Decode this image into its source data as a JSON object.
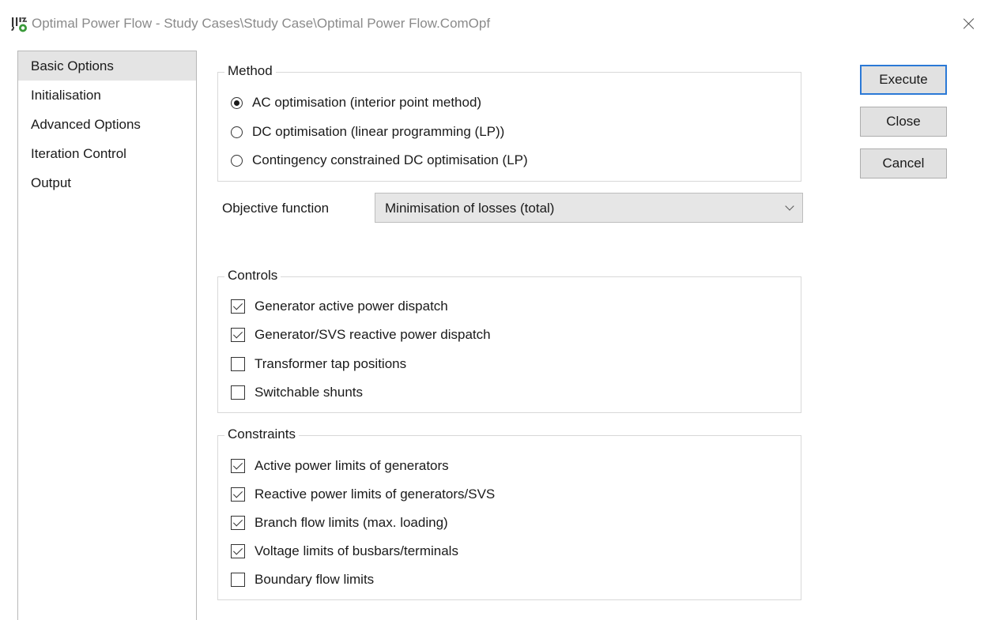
{
  "window": {
    "title": "Optimal Power Flow - Study Cases\\Study Case\\Optimal Power Flow.ComOpf",
    "icon": "powerfactory-app-icon",
    "close_icon": "close-icon"
  },
  "nav": {
    "items": [
      {
        "label": "Basic Options",
        "selected": true
      },
      {
        "label": "Initialisation",
        "selected": false
      },
      {
        "label": "Advanced Options",
        "selected": false
      },
      {
        "label": "Iteration Control",
        "selected": false
      },
      {
        "label": "Output",
        "selected": false
      }
    ]
  },
  "method": {
    "title": "Method",
    "options": [
      {
        "label": "AC optimisation (interior point method)",
        "selected": true
      },
      {
        "label": "DC optimisation (linear programming (LP))",
        "selected": false
      },
      {
        "label": "Contingency constrained DC optimisation (LP)",
        "selected": false
      }
    ]
  },
  "objective": {
    "label": "Objective function",
    "value": "Minimisation of losses (total)"
  },
  "controls": {
    "title": "Controls",
    "items": [
      {
        "label": "Generator active power dispatch",
        "checked": true
      },
      {
        "label": "Generator/SVS reactive power dispatch",
        "checked": true
      },
      {
        "label": "Transformer tap positions",
        "checked": false
      },
      {
        "label": "Switchable shunts",
        "checked": false
      }
    ]
  },
  "constraints": {
    "title": "Constraints",
    "items": [
      {
        "label": "Active power limits of generators",
        "checked": true
      },
      {
        "label": "Reactive power limits of generators/SVS",
        "checked": true
      },
      {
        "label": "Branch flow limits (max. loading)",
        "checked": true
      },
      {
        "label": "Voltage limits of busbars/terminals",
        "checked": true
      },
      {
        "label": "Boundary flow limits",
        "checked": false
      }
    ]
  },
  "buttons": {
    "execute": "Execute",
    "close": "Close",
    "cancel": "Cancel"
  },
  "colors": {
    "accent": "#2b79d6",
    "selection": "#e4e4e4",
    "button_face": "#e1e1e1"
  }
}
